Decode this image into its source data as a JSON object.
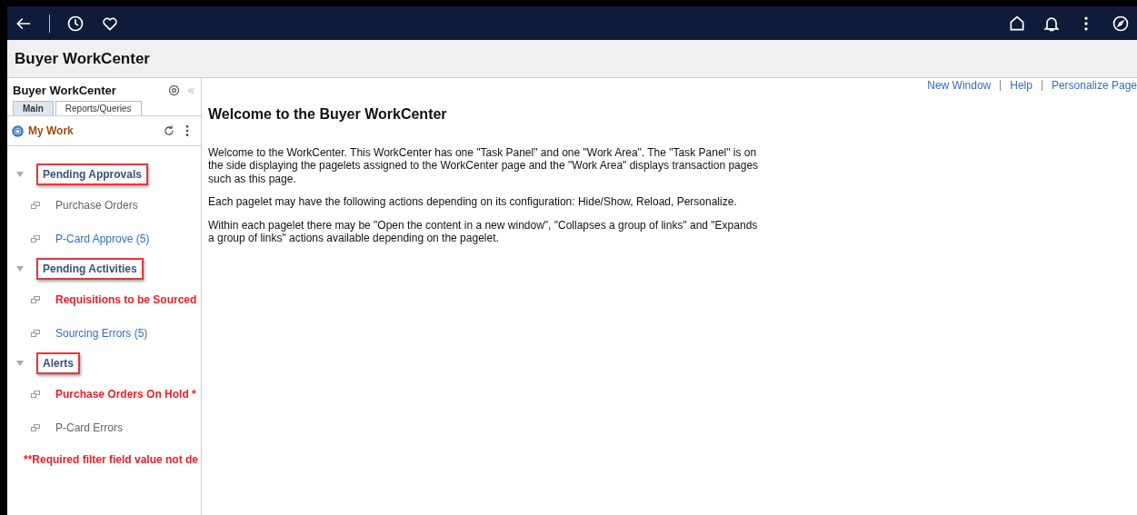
{
  "page_title": "Buyer WorkCenter",
  "panel": {
    "title": "Buyer WorkCenter",
    "tabs": [
      {
        "label": "Main",
        "selected": true
      },
      {
        "label": "Reports/Queries",
        "selected": false
      }
    ],
    "pagelet_title": "My Work",
    "groups": [
      {
        "label": "Pending Approvals",
        "expanded": true,
        "highlighted": true,
        "items": [
          {
            "label": "Purchase Orders",
            "kind": "plain"
          },
          {
            "label": "P-Card Approve (5)",
            "kind": "link"
          }
        ]
      },
      {
        "label": "Pending Activities",
        "expanded": true,
        "highlighted": true,
        "items": [
          {
            "label": "Requisitions to be Sourced",
            "kind": "alert"
          },
          {
            "label": "Sourcing Errors (5)",
            "kind": "link"
          }
        ]
      },
      {
        "label": "Alerts",
        "expanded": true,
        "highlighted": true,
        "items": [
          {
            "label": "Purchase Orders On Hold *",
            "kind": "alert"
          },
          {
            "label": "P-Card Errors",
            "kind": "plain"
          }
        ]
      }
    ],
    "footnote": "**Required filter field value not de"
  },
  "top_links": [
    "New Window",
    "Help",
    "Personalize Page"
  ],
  "content": {
    "heading": "Welcome to the Buyer WorkCenter",
    "paragraphs": [
      "Welcome to the WorkCenter. This WorkCenter has one \"Task Panel\" and one \"Work Area\". The \"Task Panel\" is on the side displaying the pagelets assigned to the WorkCenter page and the \"Work Area\" displays transaction pages such as this page.",
      "Each pagelet may have the following actions depending on its configuration: Hide/Show, Reload, Personalize.",
      "Within each pagelet there may be \"Open the content in a new window\", \"Collapses a group of links\" and \"Expands a group of links\" actions available depending on the pagelet."
    ]
  }
}
